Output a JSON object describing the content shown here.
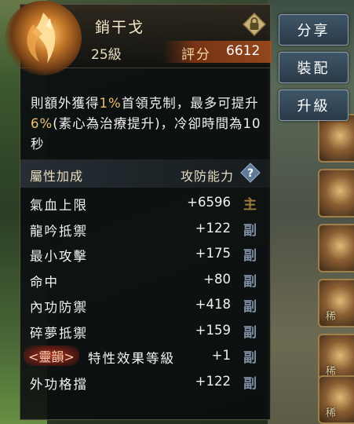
{
  "item": {
    "name": "銷干戈",
    "level": "25級",
    "score_label": "評分",
    "score_value": "6612",
    "icon": "blade-emblem-icon",
    "lock_icon": "lock-icon"
  },
  "description": {
    "part1": "則額外獲得",
    "hl1": "1%",
    "part2": "首領克制，最多可提升",
    "hl2": "6%",
    "part3": "(素心為治療提升)，冷卻時間為10秒"
  },
  "attributes": {
    "header_label": "屬性加成",
    "header_right": "攻防能力",
    "help_icon": "question-icon",
    "rows": [
      {
        "name": "氣血上限",
        "value": "+6596",
        "tag": "主"
      },
      {
        "name": "龍吟抵禦",
        "value": "+122",
        "tag": "副"
      },
      {
        "name": "最小攻擊",
        "value": "+175",
        "tag": "副"
      },
      {
        "name": "命中",
        "value": "+80",
        "tag": "副"
      },
      {
        "name": "內功防禦",
        "value": "+418",
        "tag": "副"
      },
      {
        "name": "碎夢抵禦",
        "value": "+159",
        "tag": "副"
      },
      {
        "name": "特性效果等級",
        "value": "+1",
        "tag": "副",
        "badge": "<靈韻>"
      },
      {
        "name": "外功格擋",
        "value": "+122",
        "tag": "副"
      }
    ]
  },
  "buttons": {
    "share": "分享",
    "equip": "裝配",
    "upgrade": "升級"
  },
  "side_slots": [
    "",
    "",
    "",
    "",
    "稀",
    "稀",
    "稀"
  ],
  "colors": {
    "highlight": "#e8c070",
    "tag_main": "#9c7a3c",
    "tag_sub": "#7d8ea3"
  }
}
